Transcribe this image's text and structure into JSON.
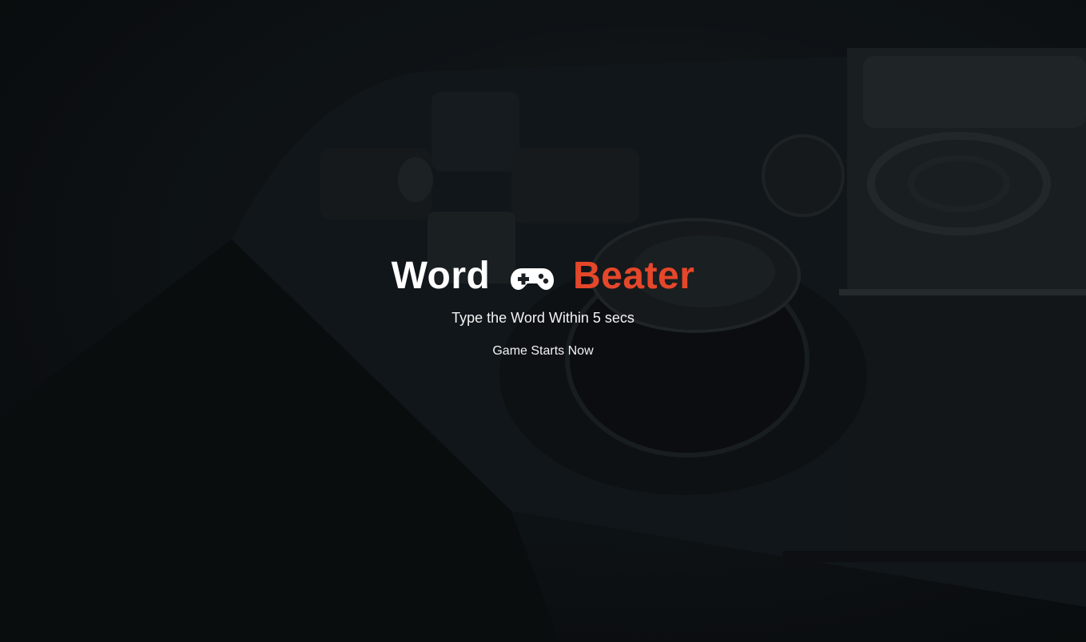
{
  "app": {
    "title_part1": "Word",
    "title_part2": "Beater",
    "title_icon": "gamepad-icon",
    "accent_color": "#e5472a"
  },
  "instructions": "Type the Word Within 5 secs",
  "status": "Game Starts Now"
}
